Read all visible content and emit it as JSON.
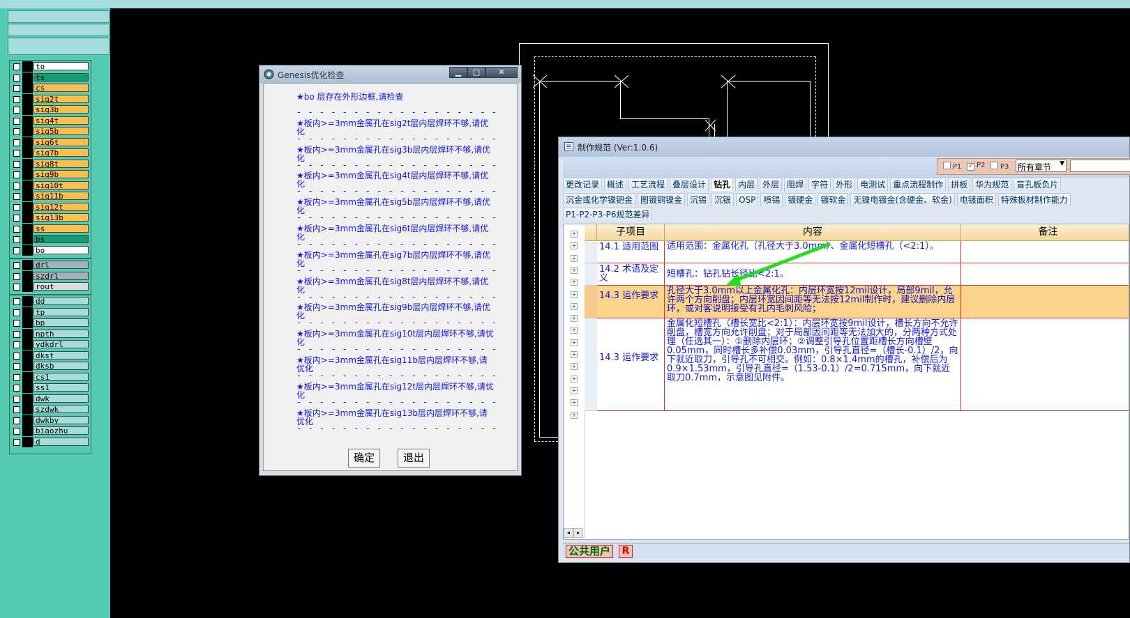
{
  "layers": {
    "group1": [
      {
        "name": "to",
        "color": "#ffffff"
      },
      {
        "name": "ts",
        "color": "#119c75"
      },
      {
        "name": "cs",
        "color": "#f9c04e"
      },
      {
        "name": "sig2t",
        "color": "#f9c04e"
      },
      {
        "name": "sig3b",
        "color": "#f9c04e"
      },
      {
        "name": "sig4t",
        "color": "#f9c04e"
      },
      {
        "name": "sig5b",
        "color": "#f9c04e"
      },
      {
        "name": "sig6t",
        "color": "#f9c04e"
      },
      {
        "name": "sig7b",
        "color": "#f9c04e"
      },
      {
        "name": "sig8t",
        "color": "#f9c04e"
      },
      {
        "name": "sig9b",
        "color": "#f9c04e"
      },
      {
        "name": "sig10t",
        "color": "#f9c04e"
      },
      {
        "name": "sig11b",
        "color": "#f9c04e"
      },
      {
        "name": "sig12t",
        "color": "#f9c04e"
      },
      {
        "name": "sig13b",
        "color": "#f9c04e"
      },
      {
        "name": "ss",
        "color": "#f9c04e"
      },
      {
        "name": "bs",
        "color": "#119c75"
      },
      {
        "name": "bo",
        "color": "#ffffff"
      }
    ],
    "group2": [
      {
        "name": "drl",
        "color": "#9fb4bc"
      },
      {
        "name": "szdrl",
        "color": "#9fb4bc"
      },
      {
        "name": "rout",
        "color": "#dcdcdc"
      }
    ],
    "group3": [
      {
        "name": "dd",
        "color": "#a6dcdc"
      },
      {
        "name": "tp",
        "color": "#a6dcdc"
      },
      {
        "name": "bp",
        "color": "#a6dcdc"
      },
      {
        "name": "npth",
        "color": "#a6dcdc"
      },
      {
        "name": "ydkdrl",
        "color": "#a6dcdc"
      },
      {
        "name": "dkst",
        "color": "#a6dcdc"
      },
      {
        "name": "dksb",
        "color": "#a6dcdc"
      },
      {
        "name": "cs1",
        "color": "#a6dcdc"
      },
      {
        "name": "ss1",
        "color": "#a6dcdc"
      },
      {
        "name": "dwk",
        "color": "#a6dcdc"
      },
      {
        "name": "szdwk",
        "color": "#a6dcdc"
      },
      {
        "name": "dwkby",
        "color": "#a6dcdc"
      },
      {
        "name": "biaozhu",
        "color": "#a6dcdc"
      },
      {
        "name": "d",
        "color": "#a6dcdc"
      }
    ]
  },
  "genesis_dialog": {
    "title": "Genesis优化检查",
    "minimize": "▁",
    "maximize": "□",
    "close": "✕",
    "dash": "- - - - - - - - - - - - - - - - - - - - - -",
    "messages": [
      "★bo 层存在外形边框,请检查",
      "★板内>=3mm金属孔在sig2t层内层焊环不够,请优化",
      "★板内>=3mm金属孔在sig3b层内层焊环不够,请优化",
      "★板内>=3mm金属孔在sig4t层内层焊环不够,请优化",
      "★板内>=3mm金属孔在sig5b层内层焊环不够,请优化",
      "★板内>=3mm金属孔在sig6t层内层焊环不够,请优化",
      "★板内>=3mm金属孔在sig7b层内层焊环不够,请优化",
      "★板内>=3mm金属孔在sig8t层内层焊环不够,请优化",
      "★板内>=3mm金属孔在sig9b层内层焊环不够,请优化",
      "★板内>=3mm金属孔在sig10t层内层焊环不够,请优化",
      "★板内>=3mm金属孔在sig11b层内层焊环不够,请优化",
      "★板内>=3mm金属孔在sig12t层内层焊环不够,请优化",
      "★板内>=3mm金属孔在sig13b层内层焊环不够,请优化"
    ],
    "ok_label": "确定",
    "exit_label": "退出"
  },
  "spec_window": {
    "title": "制作规范 (Ver:1.0.6)",
    "p_options": [
      {
        "label": "P1",
        "checked": false
      },
      {
        "label": "P2",
        "checked": true
      },
      {
        "label": "P3",
        "checked": false
      }
    ],
    "chapter_select": "所有章节",
    "tabs_row1": [
      "更改记录",
      "概述",
      "工艺流程",
      "叠层设计",
      "钻孔",
      "内层",
      "外层",
      "阻焊",
      "字符",
      "外形",
      "电测试",
      "重点流程制作",
      "拼板",
      "华为规范",
      "盲孔板负片"
    ],
    "active_tab": "钻孔",
    "tabs_row2": [
      "沉金或化学镍钯金",
      "图镀铜镍金",
      "沉锡",
      "沉银",
      "OSP",
      "喷锡",
      "镀硬金",
      "镀软金",
      "无镍电镀金(含硬金、软金)",
      "电镀面积",
      "特殊板材制作能力"
    ],
    "tabs_row3": [
      "P1-P2-P3-P6规范差异"
    ],
    "table": {
      "headers": [
        "子项目",
        "内容",
        "备注"
      ],
      "rows": [
        {
          "sub": "14.1 适用范围",
          "content": "适用范围：金属化孔（孔径大于3.0mm）、金属化短槽孔（<2:1）。"
        },
        {
          "sub": "14.2 术语及定义",
          "content": "短槽孔：钻孔钻长径比<2:1。"
        },
        {
          "sub": "14.3 运作要求",
          "content": "孔径大于3.0mm以上金属化孔：内层环宽按12mil设计，局部9mil，允许两个方向削盘；内层环宽因间距等无法按12mil制作时，建议删除内层环，或对客说明接受有孔内毛刺风险；"
        },
        {
          "sub": "14.3 运作要求",
          "content": "金属化短槽孔（槽长宽比<2:1）：内层环宽按9mil设计，槽长方向不允许削盘，槽宽方向允许削盘；对于局部因间距等无法加大的，分两种方式处理（任选其一）：①删除内层环；②调整引导孔位置距槽长方向槽壁0.05mm，同时槽长多补偿0.03mm，引导孔直径=（槽长-0.1）/2，向下就近取刀，引导孔不可相交。例如：0.8×1.4mm的槽孔，补偿后为0.9×1.53mm，引导孔直径=（1.53-0.1）/2=0.715mm，向下就近取刀0.7mm，示意图见附件。"
        }
      ]
    },
    "status_user": "公共用户",
    "status_r": "R",
    "arrow_color": "#22dd22"
  }
}
